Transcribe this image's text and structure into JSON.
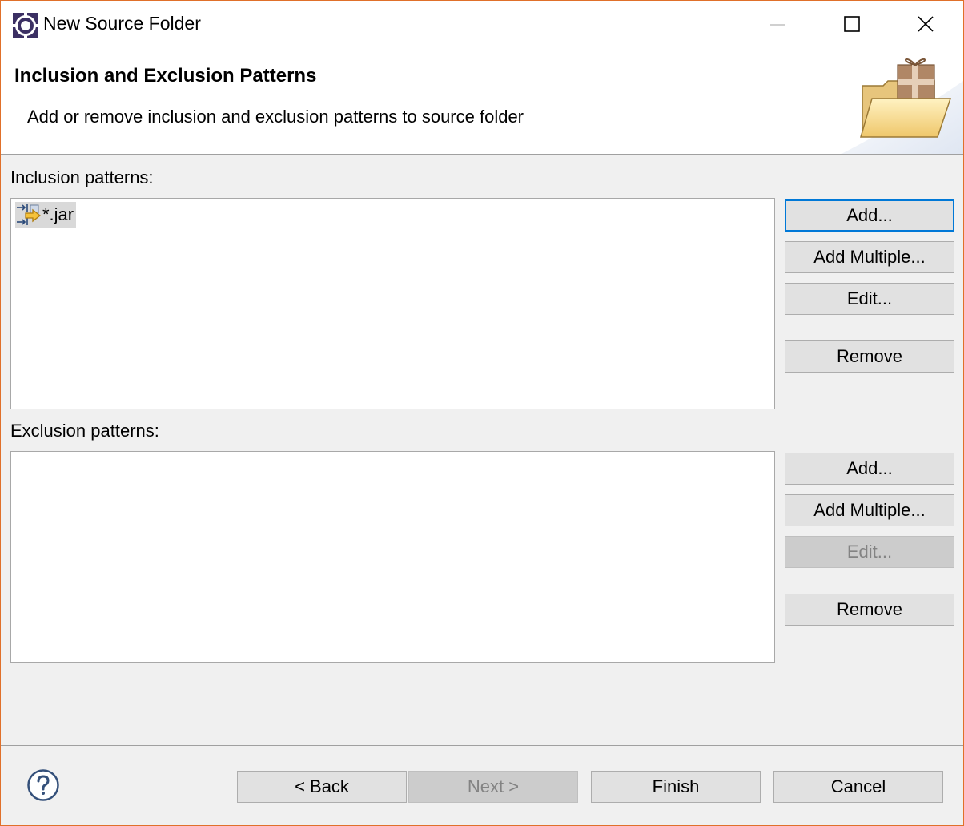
{
  "window": {
    "title": "New Source Folder",
    "border_color": "#e0702a"
  },
  "banner": {
    "title": "Inclusion and Exclusion Patterns",
    "description": "Add or remove inclusion and exclusion patterns to source folder"
  },
  "inclusion": {
    "label": "Inclusion patterns:",
    "items": [
      {
        "text": "*.jar",
        "icon": "inclusion-pattern-icon",
        "selected": true
      }
    ],
    "buttons": {
      "add": "Add...",
      "add_multiple": "Add Multiple...",
      "edit": "Edit...",
      "remove": "Remove"
    }
  },
  "exclusion": {
    "label": "Exclusion patterns:",
    "items": [],
    "buttons": {
      "add": "Add...",
      "add_multiple": "Add Multiple...",
      "edit": "Edit...",
      "remove": "Remove"
    }
  },
  "footer": {
    "back": "< Back",
    "next": "Next >",
    "finish": "Finish",
    "cancel": "Cancel"
  },
  "colors": {
    "focus_accent": "#0078d7",
    "disabled_text": "#838383"
  }
}
